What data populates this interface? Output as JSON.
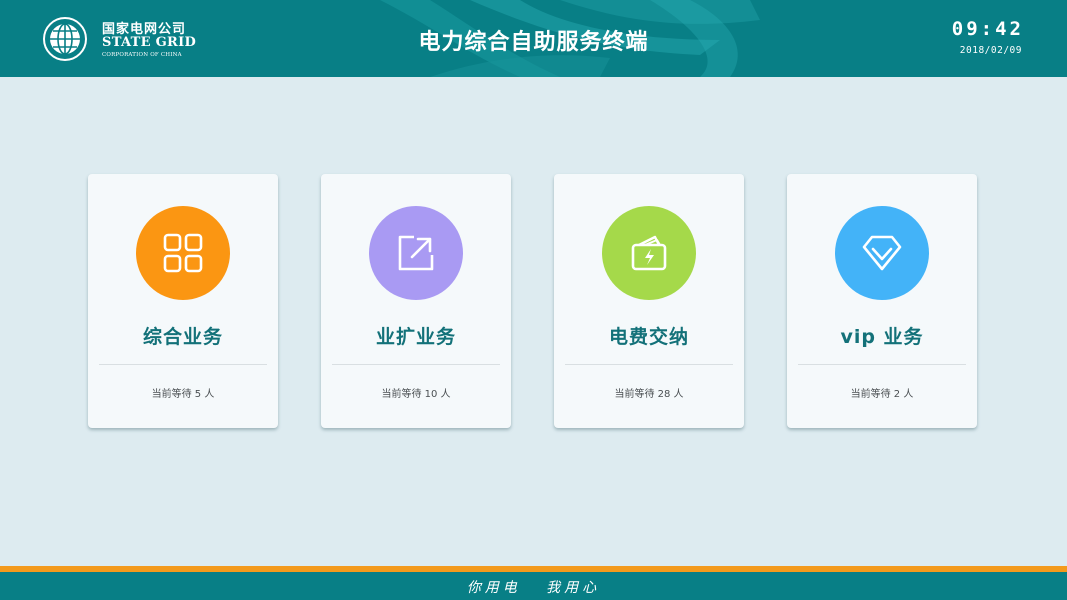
{
  "header": {
    "logo_cn": "国家电网公司",
    "logo_en": "STATE GRID",
    "logo_sub": "CORPORATION OF CHINA",
    "title": "电力综合自助服务终端",
    "time": "09:42",
    "date": "2018/02/09"
  },
  "services": [
    {
      "title": "综合业务",
      "waiting": "当前等待 5 人",
      "icon": "grid-icon",
      "color": "#fb9612"
    },
    {
      "title": "业扩业务",
      "waiting": "当前等待 10 人",
      "icon": "expand-arrow-icon",
      "color": "#a99af3"
    },
    {
      "title": "电费交纳",
      "waiting": "当前等待 28 人",
      "icon": "wallet-bolt-icon",
      "color": "#a5d94a"
    },
    {
      "title": "vip 业务",
      "waiting": "当前等待 2 人",
      "icon": "diamond-icon",
      "color": "#43b3f8"
    }
  ],
  "footer": {
    "slogan": "你用电   我用心"
  },
  "colors": {
    "header_bg": "#087f86",
    "page_bg": "#ddebf0",
    "accent_stripe": "#f39a1c",
    "title_text": "#137179"
  }
}
